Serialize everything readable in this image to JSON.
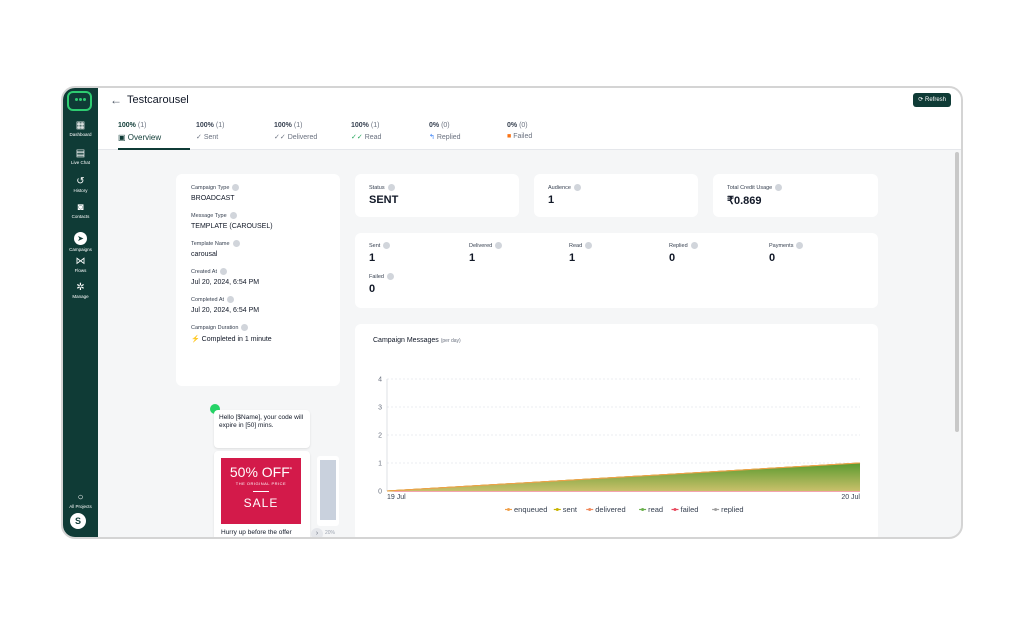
{
  "sidebar": {
    "items": [
      {
        "label": "Dashboard",
        "icon": "dashboard-icon",
        "glyph": "▦"
      },
      {
        "label": "Live Chat",
        "icon": "chat-icon",
        "glyph": "▤"
      },
      {
        "label": "History",
        "icon": "history-icon",
        "glyph": "↺"
      },
      {
        "label": "Contacts",
        "icon": "contacts-icon",
        "glyph": "◙"
      },
      {
        "label": "Campaigns",
        "icon": "campaigns-icon",
        "glyph": "➤"
      },
      {
        "label": "Flows",
        "icon": "flows-icon",
        "glyph": "⋈"
      },
      {
        "label": "Manage",
        "icon": "manage-icon",
        "glyph": "✲"
      }
    ],
    "all_projects": {
      "label": "All Projects",
      "glyph": "○"
    },
    "avatar": "S"
  },
  "header": {
    "back": "←",
    "title": "Testcarousel",
    "refresh": "⟳ Refresh"
  },
  "tabs": [
    {
      "pct": "100%",
      "count": "(1)",
      "label": "Overview",
      "icon": "▣"
    },
    {
      "pct": "100%",
      "count": "(1)",
      "label": "Sent",
      "icon": "✓"
    },
    {
      "pct": "100%",
      "count": "(1)",
      "label": "Delivered",
      "icon": "✓✓"
    },
    {
      "pct": "100%",
      "count": "(1)",
      "label": "Read",
      "icon": "✓✓"
    },
    {
      "pct": "0%",
      "count": "(0)",
      "label": "Replied",
      "icon": "↰"
    },
    {
      "pct": "0%",
      "count": "(0)",
      "label": "Failed",
      "icon": "■"
    }
  ],
  "details": {
    "campaign_type": {
      "label": "Campaign Type",
      "value": "BROADCAST"
    },
    "message_type": {
      "label": "Message Type",
      "value": "TEMPLATE (CAROUSEL)"
    },
    "template_name": {
      "label": "Template Name",
      "value": "carousal"
    },
    "created_at": {
      "label": "Created At",
      "value": "Jul 20, 2024, 6:54 PM"
    },
    "completed_at": {
      "label": "Completed At",
      "value": "Jul 20, 2024, 6:54 PM"
    },
    "duration": {
      "label": "Campaign Duration",
      "value": "⚡ Completed in 1 minute"
    }
  },
  "summary": {
    "status": {
      "label": "Status",
      "value": "SENT"
    },
    "audience": {
      "label": "Audience",
      "value": "1"
    },
    "credit": {
      "label": "Total Credit Usage",
      "value": "₹0.869"
    }
  },
  "stats": {
    "sent": {
      "label": "Sent",
      "value": "1"
    },
    "delivered": {
      "label": "Delivered",
      "value": "1"
    },
    "read": {
      "label": "Read",
      "value": "1"
    },
    "replied": {
      "label": "Replied",
      "value": "0"
    },
    "payments": {
      "label": "Payments",
      "value": "0"
    },
    "failed": {
      "label": "Failed",
      "value": "0"
    }
  },
  "preview": {
    "message": "Hello [$Name], your code will expire in [50] mins.",
    "sale_off": "50% OFF",
    "sale_star": "*",
    "sale_sub": "THE ORIGINAL PRICE",
    "sale_word": "SALE",
    "hurry": "Hurry up before the offer",
    "next_arrow": "›",
    "next_pct": "20%"
  },
  "chart": {
    "title": "Campaign Messages",
    "subtitle": "(per day)"
  },
  "chart_data": {
    "type": "area",
    "x": [
      "19 Jul",
      "20 Jul"
    ],
    "ylim": [
      0,
      4
    ],
    "yticks": [
      0,
      1,
      2,
      3,
      4
    ],
    "grid": true,
    "legend_position": "bottom",
    "series": [
      {
        "name": "enqueued",
        "color": "#f0a04b",
        "values": [
          0,
          1
        ]
      },
      {
        "name": "sent",
        "color": "#c8b400",
        "values": [
          0,
          1
        ]
      },
      {
        "name": "delivered",
        "color": "#f08a5d",
        "values": [
          0,
          1
        ]
      },
      {
        "name": "read",
        "color": "#6ab04c",
        "values": [
          0,
          1
        ]
      },
      {
        "name": "failed",
        "color": "#e84a5f",
        "values": [
          0,
          0
        ]
      },
      {
        "name": "replied",
        "color": "#a0a0a0",
        "values": [
          0,
          0
        ]
      }
    ]
  }
}
